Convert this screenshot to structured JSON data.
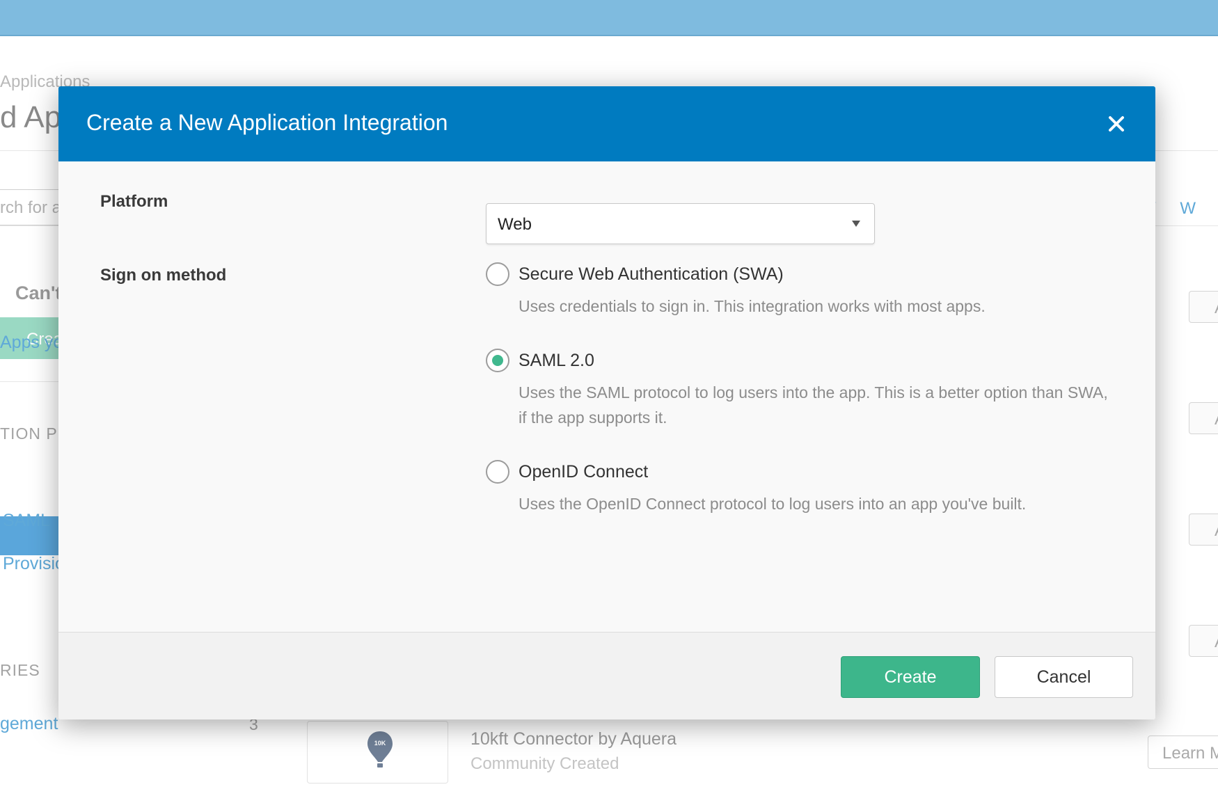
{
  "background": {
    "breadcrumb": "Applications",
    "page_title": "d App",
    "search_placeholder": "rch for a",
    "alpha_letters": "V W",
    "cant_find": "Can't",
    "create_button": "Crea",
    "apps_link": "Apps yo",
    "section_protocols": "TION PF",
    "link_saml": "SAML",
    "link_provisioning": "Provisio",
    "section_categories": "RIES",
    "category_item": "gement",
    "category_count": "3",
    "right_button_label": "A",
    "app_card": {
      "logo_text": "10K",
      "name": "10kft Connector by Aquera",
      "subtitle": "Community Created",
      "learn_more": "Learn M"
    }
  },
  "modal": {
    "title": "Create a New Application Integration",
    "platform": {
      "label": "Platform",
      "value": "Web"
    },
    "sign_on": {
      "label": "Sign on method",
      "options": [
        {
          "label": "Secure Web Authentication (SWA)",
          "description": "Uses credentials to sign in. This integration works with most apps.",
          "checked": false
        },
        {
          "label": "SAML 2.0",
          "description": "Uses the SAML protocol to log users into the app. This is a better option than SWA, if the app supports it.",
          "checked": true
        },
        {
          "label": "OpenID Connect",
          "description": "Uses the OpenID Connect protocol to log users into an app you've built.",
          "checked": false
        }
      ]
    },
    "buttons": {
      "create": "Create",
      "cancel": "Cancel"
    }
  },
  "colors": {
    "header_blue": "#007bc0",
    "accent_green": "#3db68b",
    "topbar_blue": "#7fbbdf"
  },
  "icons": {
    "close": "close-icon",
    "dropdown": "caret-down-icon",
    "app_logo": "balloon-icon"
  }
}
